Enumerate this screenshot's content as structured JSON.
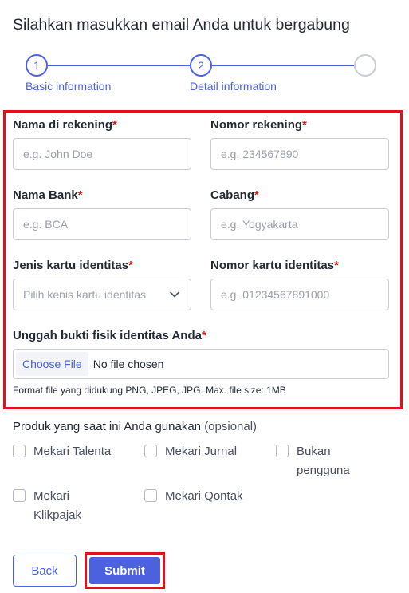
{
  "page": {
    "title": "Silahkan masukkan email Anda untuk bergabung"
  },
  "stepper": {
    "steps": [
      {
        "number": "1",
        "label": "Basic information"
      },
      {
        "number": "2",
        "label": "Detail information"
      },
      {
        "number": "",
        "label": ""
      }
    ],
    "accent_color": "#4b61dd"
  },
  "form": {
    "account_name": {
      "label": "Nama di rekening",
      "placeholder": "e.g. John Doe"
    },
    "account_number": {
      "label": "Nomor rekening",
      "placeholder": "e.g. 234567890"
    },
    "bank_name": {
      "label": "Nama Bank",
      "placeholder": "e.g. BCA"
    },
    "branch": {
      "label": "Cabang",
      "placeholder": "e.g. Yogyakarta"
    },
    "id_type": {
      "label": "Jenis kartu identitas",
      "placeholder": "Pilih kenis kartu identitas"
    },
    "id_number": {
      "label": "Nomor kartu identitas",
      "placeholder": "e.g. 01234567891000"
    },
    "upload": {
      "label": "Unggah bukti fisik identitas Anda",
      "button": "Choose File",
      "status": "No file chosen",
      "hint": "Format file yang didukung PNG, JPEG, JPG. Max. file size: 1MB"
    },
    "required_mark": "*"
  },
  "products": {
    "label": "Produk yang saat ini Anda gunakan",
    "optional": "(opsional)",
    "options": [
      {
        "label": "Mekari Talenta"
      },
      {
        "label": "Mekari Jurnal"
      },
      {
        "label": "Bukan pengguna"
      },
      {
        "label": "Mekari Klikpajak"
      },
      {
        "label": "Mekari Qontak"
      }
    ]
  },
  "actions": {
    "back": "Back",
    "submit": "Submit"
  },
  "colors": {
    "primary": "#4b61dd",
    "required": "#d21d1d",
    "highlight": "#e0101e"
  }
}
